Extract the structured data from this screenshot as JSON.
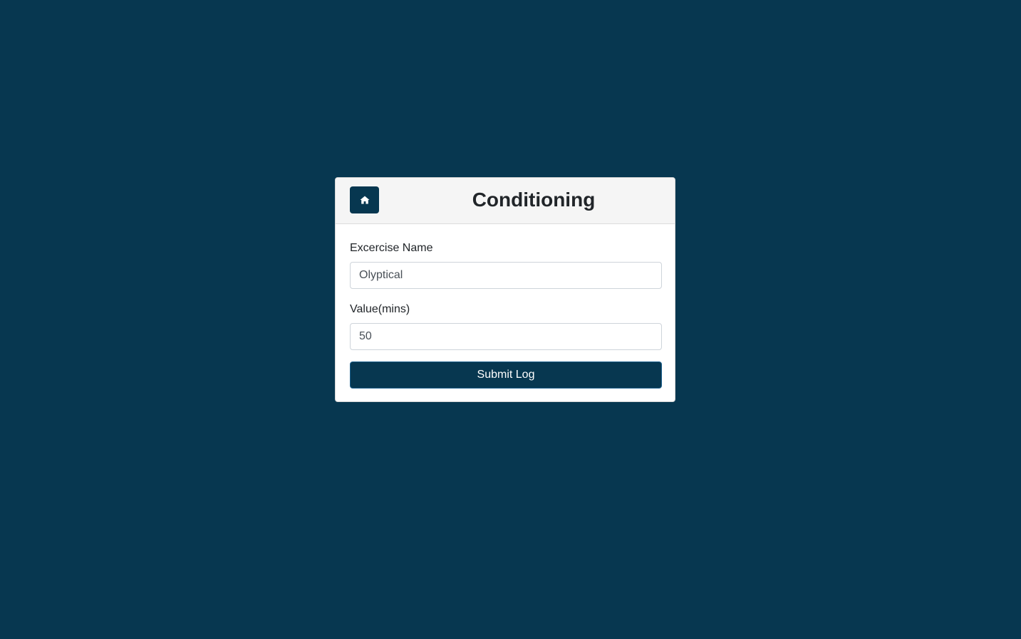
{
  "header": {
    "title": "Conditioning",
    "home_icon": "home-icon"
  },
  "form": {
    "exercise_label": "Excercise Name",
    "exercise_value": "Olyptical",
    "value_label": "Value(mins)",
    "value_value": "50",
    "submit_label": "Submit Log"
  },
  "colors": {
    "background": "#073750",
    "accent": "#073750",
    "card": "#ffffff",
    "header": "#f5f5f5"
  }
}
